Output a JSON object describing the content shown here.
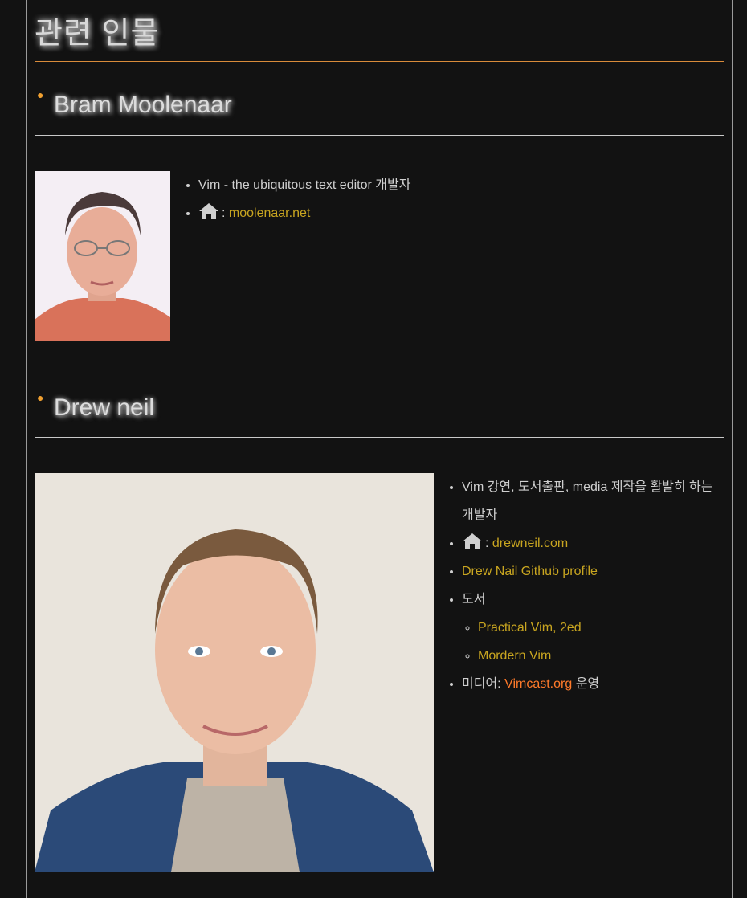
{
  "page": {
    "title": "관련 인물"
  },
  "people": [
    {
      "name": "Bram Moolenaar",
      "items": {
        "desc": "Vim - the ubiquitous text editor 개발자",
        "home_sep": ":",
        "home_link": "moolenaar.net"
      }
    },
    {
      "name": "Drew neil",
      "items": {
        "desc": "Vim 강연, 도서출판, media 제작을 활발히 하는 개발자",
        "home_sep": ":",
        "home_link": "drewneil.com",
        "github_link": "Drew Nail Github profile",
        "books_label": "도서",
        "books": [
          "Practical Vim, 2ed",
          "Mordern Vim"
        ],
        "media_prefix": "미디어:",
        "media_link": "Vimcast.org",
        "media_suffix": "운영"
      }
    }
  ],
  "colors": {
    "background": "#121212",
    "text": "#cfcfcf",
    "link": "#c8a520",
    "link_accent": "#ff7a2a",
    "title_rule": "#d98b3a"
  },
  "icons": {
    "home": "home-icon",
    "section_bullet": "orange-dot"
  }
}
